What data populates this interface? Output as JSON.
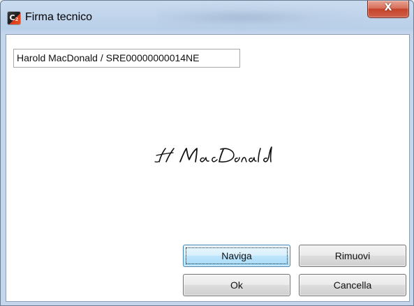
{
  "window": {
    "title": "Firma tecnico",
    "app_icon": "c2-app-icon",
    "close_glyph": "X",
    "colors": {
      "titlebar": "#b9cfe8",
      "close_button": "#c4432b",
      "focused_button": "#bee6fd"
    }
  },
  "technician": {
    "name_id": "Harold MacDonald / SRE00000000014NE"
  },
  "signature": {
    "kind": "handwritten-signature-image",
    "text": "H MacDonald"
  },
  "buttons": {
    "browse": "Naviga",
    "remove": "Rimuovi",
    "ok": "Ok",
    "cancel": "Cancella"
  }
}
